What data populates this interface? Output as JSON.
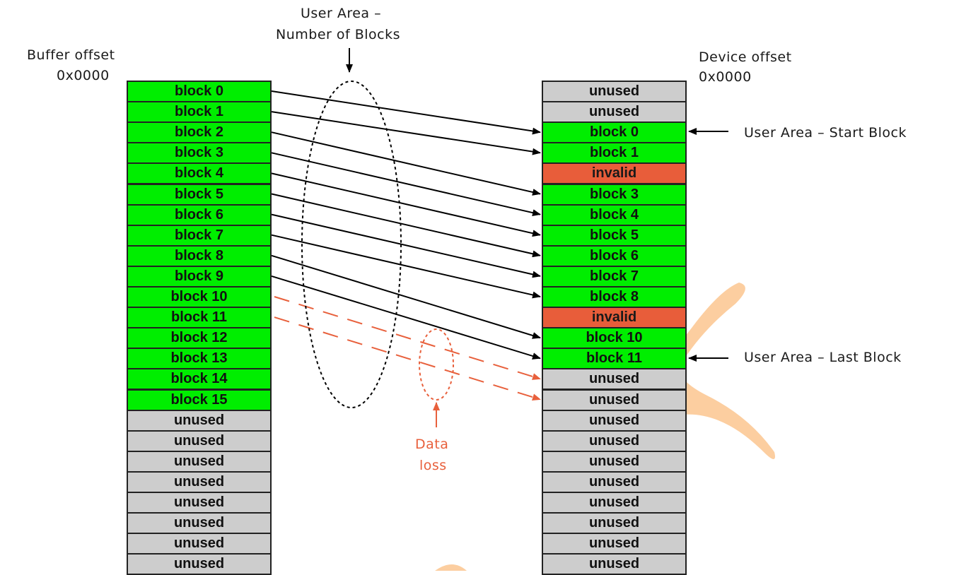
{
  "labels": {
    "buffer_offset": "Buffer offset",
    "buffer_addr": "0x0000",
    "device_offset": "Device offset",
    "device_addr": "0x0000",
    "num_blocks_line1": "User Area –",
    "num_blocks_line2": "Number of Blocks",
    "start_block": "User Area – Start Block",
    "last_block": "User Area – Last Block",
    "data_loss_line1": "Data",
    "data_loss_line2": "loss"
  },
  "buffer_blocks": [
    {
      "label": "block 0",
      "state": "green"
    },
    {
      "label": "block 1",
      "state": "green"
    },
    {
      "label": "block 2",
      "state": "green"
    },
    {
      "label": "block 3",
      "state": "green"
    },
    {
      "label": "block 4",
      "state": "green"
    },
    {
      "label": "block 5",
      "state": "green"
    },
    {
      "label": "block 6",
      "state": "green"
    },
    {
      "label": "block 7",
      "state": "green"
    },
    {
      "label": "block 8",
      "state": "green"
    },
    {
      "label": "block 9",
      "state": "green"
    },
    {
      "label": "block 10",
      "state": "green"
    },
    {
      "label": "block 11",
      "state": "green"
    },
    {
      "label": "block 12",
      "state": "green"
    },
    {
      "label": "block 13",
      "state": "green"
    },
    {
      "label": "block 14",
      "state": "green"
    },
    {
      "label": "block 15",
      "state": "green"
    },
    {
      "label": "unused",
      "state": "gray"
    },
    {
      "label": "unused",
      "state": "gray"
    },
    {
      "label": "unused",
      "state": "gray"
    },
    {
      "label": "unused",
      "state": "gray"
    },
    {
      "label": "unused",
      "state": "gray"
    },
    {
      "label": "unused",
      "state": "gray"
    },
    {
      "label": "unused",
      "state": "gray"
    },
    {
      "label": "unused",
      "state": "gray"
    }
  ],
  "device_blocks": [
    {
      "label": "unused",
      "state": "gray"
    },
    {
      "label": "unused",
      "state": "gray"
    },
    {
      "label": "block 0",
      "state": "green"
    },
    {
      "label": "block 1",
      "state": "green"
    },
    {
      "label": "invalid",
      "state": "red"
    },
    {
      "label": "block 3",
      "state": "green"
    },
    {
      "label": "block 4",
      "state": "green"
    },
    {
      "label": "block 5",
      "state": "green"
    },
    {
      "label": "block 6",
      "state": "green"
    },
    {
      "label": "block 7",
      "state": "green"
    },
    {
      "label": "block 8",
      "state": "green"
    },
    {
      "label": "invalid",
      "state": "red"
    },
    {
      "label": "block 10",
      "state": "green"
    },
    {
      "label": "block 11",
      "state": "green"
    },
    {
      "label": "unused",
      "state": "gray"
    },
    {
      "label": "unused",
      "state": "gray"
    },
    {
      "label": "unused",
      "state": "gray"
    },
    {
      "label": "unused",
      "state": "gray"
    },
    {
      "label": "unused",
      "state": "gray"
    },
    {
      "label": "unused",
      "state": "gray"
    },
    {
      "label": "unused",
      "state": "gray"
    },
    {
      "label": "unused",
      "state": "gray"
    },
    {
      "label": "unused",
      "state": "gray"
    },
    {
      "label": "unused",
      "state": "gray"
    }
  ],
  "mappings": [
    {
      "from": 0,
      "to": 2
    },
    {
      "from": 1,
      "to": 3
    },
    {
      "from": 2,
      "to": 5
    },
    {
      "from": 3,
      "to": 6
    },
    {
      "from": 4,
      "to": 7
    },
    {
      "from": 5,
      "to": 8
    },
    {
      "from": 6,
      "to": 9
    },
    {
      "from": 7,
      "to": 10
    },
    {
      "from": 8,
      "to": 12
    },
    {
      "from": 9,
      "to": 13
    }
  ],
  "lost_mappings": [
    {
      "from": 10,
      "to": 14
    },
    {
      "from": 11,
      "to": 15
    }
  ],
  "colors": {
    "used": "#00ee00",
    "unused": "#cdcdcd",
    "invalid": "#e85d3a",
    "loss": "#e8603c",
    "watermark": "#fbc58f"
  }
}
